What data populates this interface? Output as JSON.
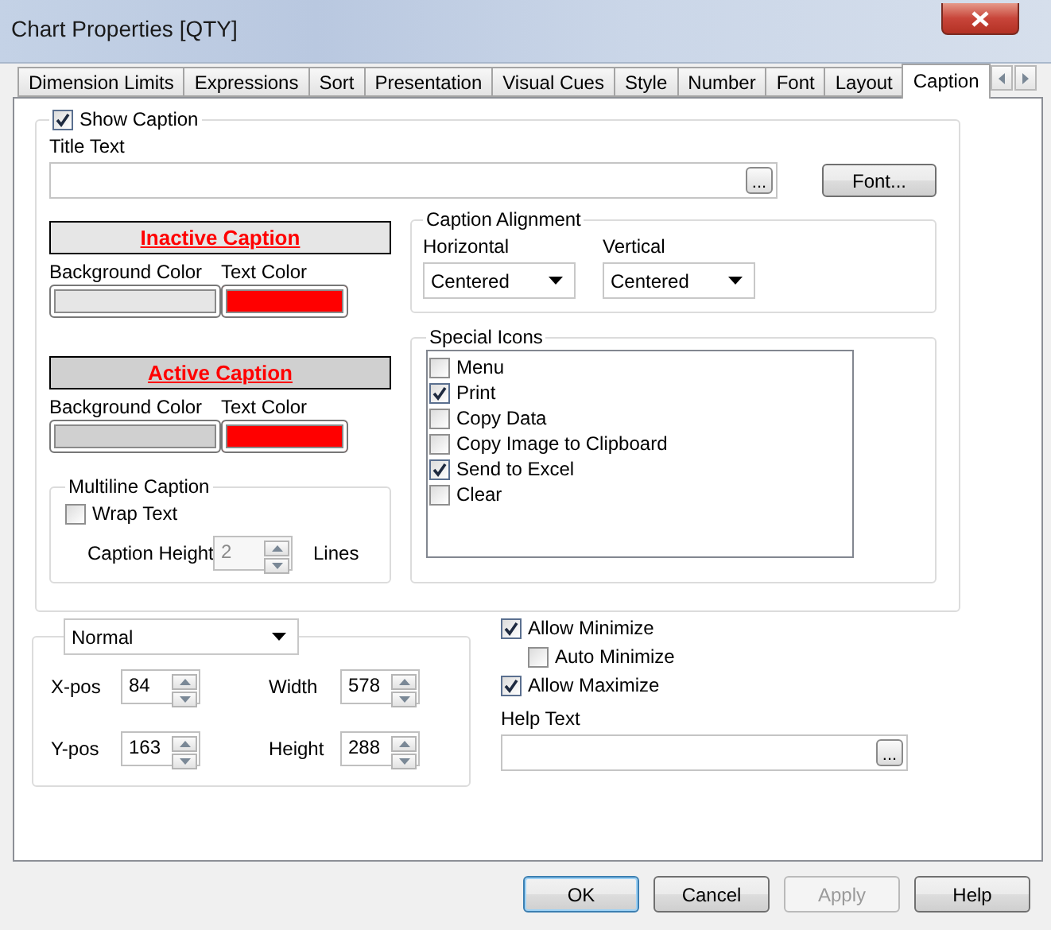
{
  "window": {
    "title": "Chart Properties [QTY]"
  },
  "tabs": [
    {
      "label": "Dimension Limits",
      "selected": false
    },
    {
      "label": "Expressions",
      "selected": false
    },
    {
      "label": "Sort",
      "selected": false
    },
    {
      "label": "Presentation",
      "selected": false
    },
    {
      "label": "Visual Cues",
      "selected": false
    },
    {
      "label": "Style",
      "selected": false
    },
    {
      "label": "Number",
      "selected": false
    },
    {
      "label": "Font",
      "selected": false
    },
    {
      "label": "Layout",
      "selected": false
    },
    {
      "label": "Caption",
      "selected": true
    }
  ],
  "show_caption": {
    "label": "Show Caption",
    "checked": true
  },
  "title_text": {
    "label": "Title Text",
    "browse_button": "..."
  },
  "font_button": "Font...",
  "captions": [
    {
      "label": "Inactive Caption",
      "swatches": [
        {
          "label": "Background Color",
          "color": "#e6e6e6"
        },
        {
          "label": "Text Color",
          "color": "#ff0000"
        }
      ]
    },
    {
      "label": "Active Caption",
      "swatches": [
        {
          "label": "Background Color",
          "color": "#d0d0d0"
        },
        {
          "label": "Text Color",
          "color": "#ff0000"
        }
      ]
    }
  ],
  "multiline_caption": {
    "title": "Multiline Caption",
    "wrap_text": {
      "label": "Wrap Text",
      "checked": false
    },
    "height_label": "Caption Height",
    "height_value": "2",
    "height_disabled": true,
    "lines_label": "Lines"
  },
  "caption_alignment": {
    "title": "Caption Alignment",
    "horizontal": {
      "label": "Horizontal",
      "value": "Centered"
    },
    "vertical": {
      "label": "Vertical",
      "value": "Centered"
    }
  },
  "special_icons": {
    "title": "Special Icons",
    "items": [
      {
        "label": "Menu",
        "checked": false
      },
      {
        "label": "Print",
        "checked": true
      },
      {
        "label": "Copy Data",
        "checked": false
      },
      {
        "label": "Copy Image to Clipboard",
        "checked": false
      },
      {
        "label": "Send to Excel",
        "checked": true
      },
      {
        "label": "Clear",
        "checked": false
      }
    ]
  },
  "position": {
    "mode": "Normal",
    "fields": [
      {
        "label": "X-pos",
        "value": "84"
      },
      {
        "label": "Width",
        "value": "578"
      },
      {
        "label": "Y-pos",
        "value": "163"
      },
      {
        "label": "Height",
        "value": "288"
      }
    ]
  },
  "window_options": [
    {
      "label": "Allow Minimize",
      "checked": true,
      "children": [
        {
          "label": "Auto Minimize",
          "checked": false
        }
      ]
    },
    {
      "label": "Allow Maximize",
      "checked": true
    }
  ],
  "help_text": {
    "label": "Help Text",
    "browse_button": "..."
  },
  "buttons": [
    {
      "label": "OK",
      "default": true,
      "disabled": false
    },
    {
      "label": "Cancel",
      "default": false,
      "disabled": false
    },
    {
      "label": "Apply",
      "default": false,
      "disabled": true
    },
    {
      "label": "Help",
      "default": false,
      "disabled": false
    }
  ]
}
